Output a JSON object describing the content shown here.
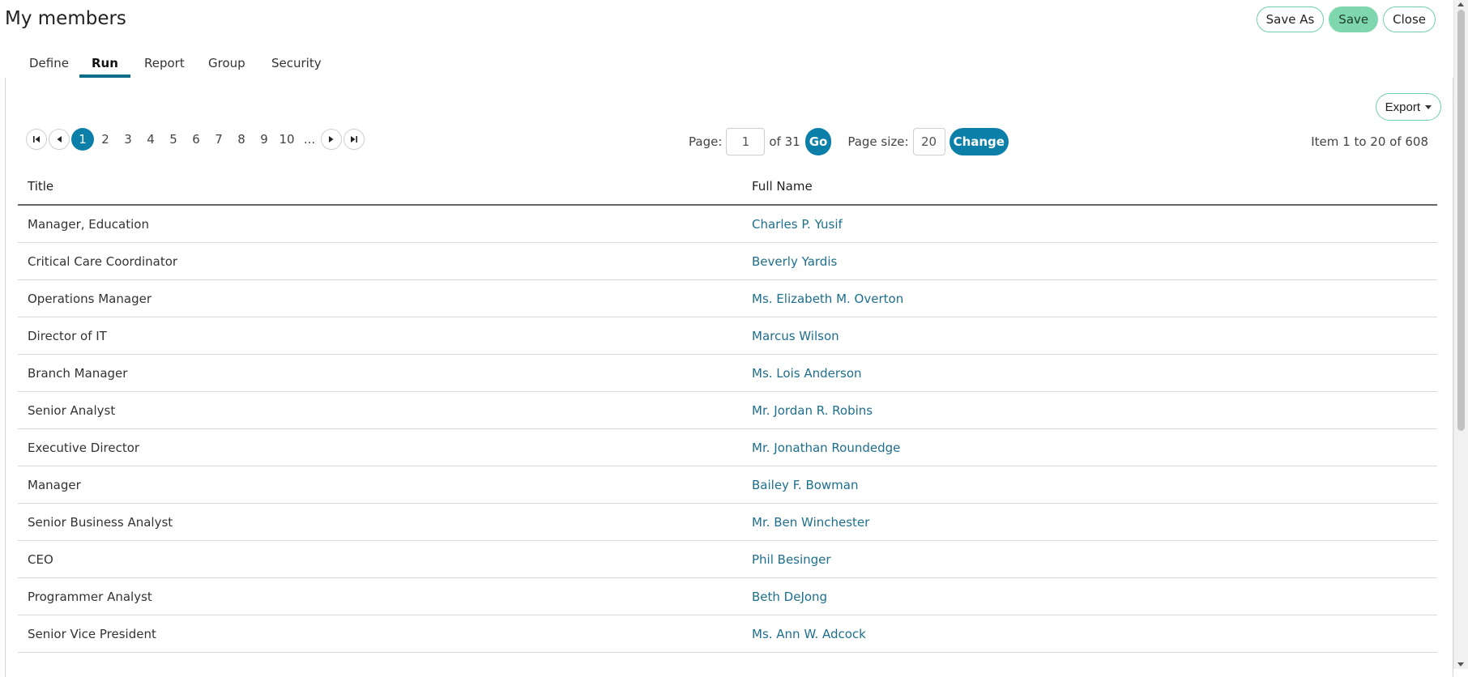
{
  "page": {
    "title": "My members"
  },
  "toolbar": {
    "save_as": "Save As",
    "save": "Save",
    "close": "Close"
  },
  "tabs": [
    {
      "label": "Define"
    },
    {
      "label": "Run",
      "active": true
    },
    {
      "label": "Report"
    },
    {
      "label": "Group"
    },
    {
      "label": "Security"
    }
  ],
  "export_label": "Export",
  "pager": {
    "pages": [
      "1",
      "2",
      "3",
      "4",
      "5",
      "6",
      "7",
      "8",
      "9",
      "10",
      "..."
    ],
    "current_page": "1",
    "page_label": "Page:",
    "page_value": "1",
    "of_total": "of 31",
    "go_label": "Go",
    "page_size_label": "Page size:",
    "page_size_value": "20",
    "change_label": "Change",
    "item_count": "Item 1 to 20 of 608"
  },
  "table": {
    "columns": [
      "Title",
      "Full Name"
    ],
    "rows": [
      [
        "Manager, Education",
        "Charles P. Yusif"
      ],
      [
        "Critical Care Coordinator",
        "Beverly Yardis"
      ],
      [
        "Operations Manager",
        "Ms. Elizabeth M. Overton"
      ],
      [
        "Director of IT",
        "Marcus Wilson"
      ],
      [
        "Branch Manager",
        "Ms. Lois Anderson"
      ],
      [
        "Senior Analyst",
        "Mr. Jordan R. Robins"
      ],
      [
        "Executive Director",
        "Mr. Jonathan Roundedge"
      ],
      [
        "Manager",
        "Bailey F. Bowman"
      ],
      [
        "Senior Business Analyst",
        "Mr. Ben Winchester"
      ],
      [
        "CEO",
        "Phil Besinger"
      ],
      [
        "Programmer Analyst",
        "Beth DeJong"
      ],
      [
        "Senior Vice President",
        "Ms. Ann W. Adcock"
      ]
    ]
  },
  "colors": {
    "accent": "#0b7fa7",
    "save_button": "#7fd8ad",
    "link": "#1d6f8d"
  }
}
